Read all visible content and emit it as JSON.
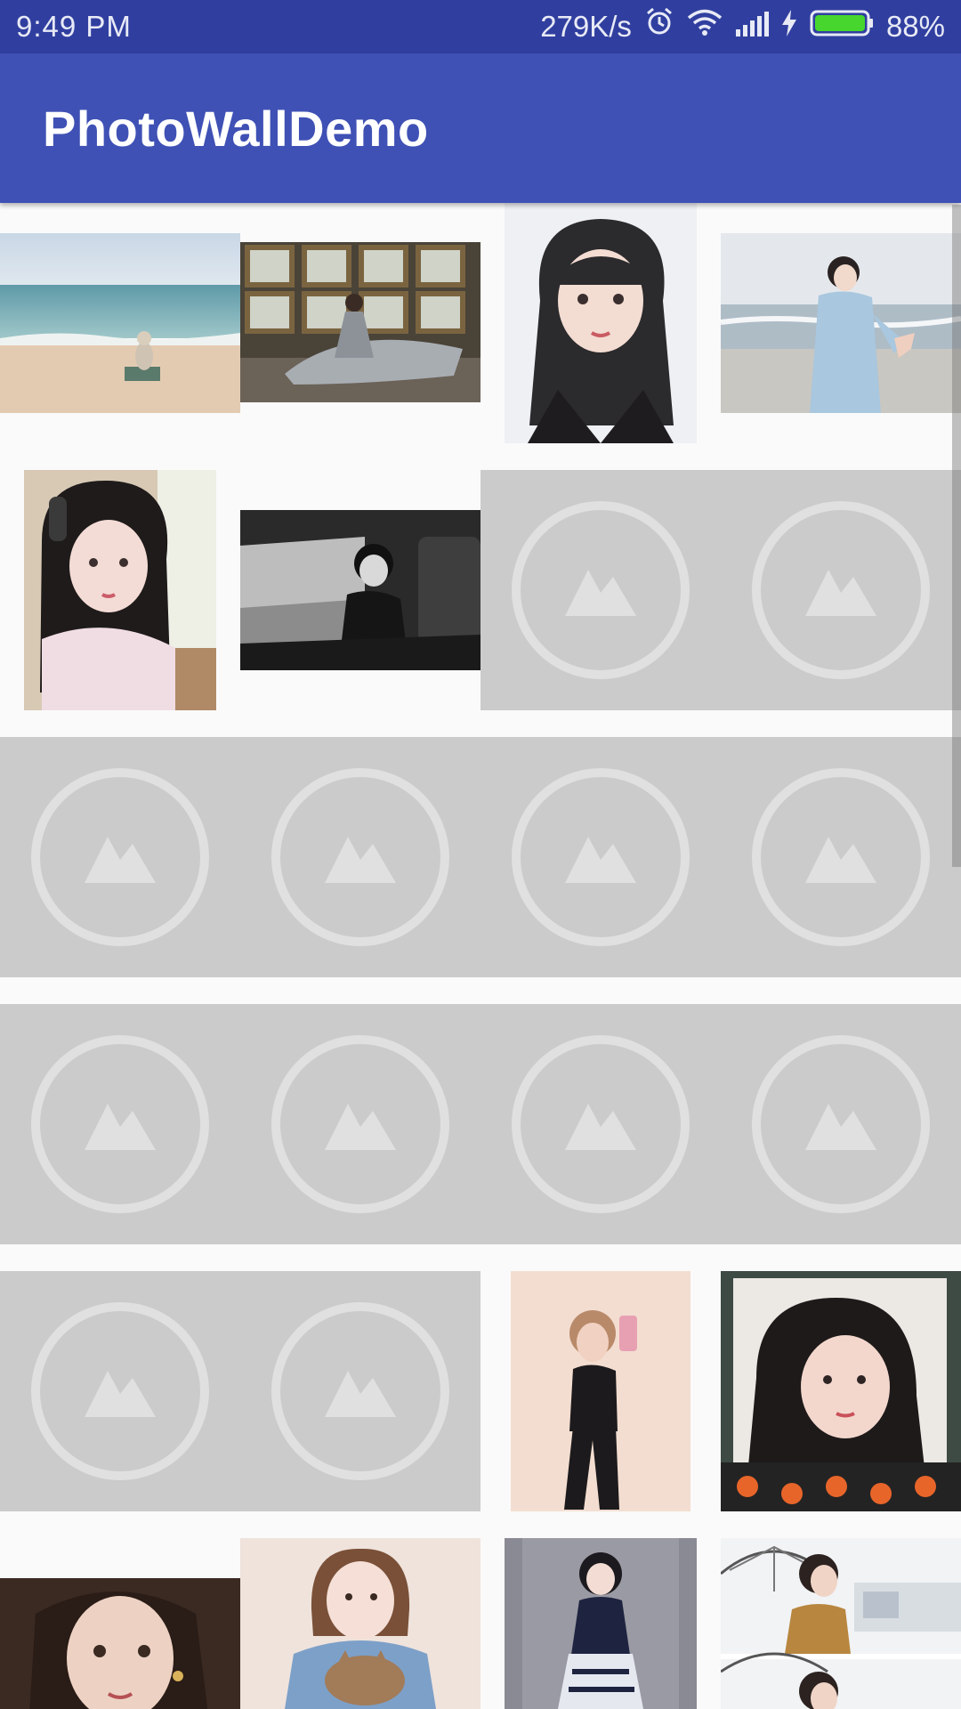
{
  "status_bar": {
    "time": "9:49  PM",
    "net_speed": "279K/s",
    "battery": "88%",
    "icons": [
      "alarm-icon",
      "wifi-icon",
      "signal-icon",
      "charging-bolt-icon",
      "battery-icon"
    ],
    "battery_level": 0.88
  },
  "app_bar": {
    "title": "PhotoWallDemo"
  },
  "colors": {
    "status_bar": "#303f9f",
    "app_bar": "#3f51b5",
    "placeholder_bg": "#cbcbcb",
    "placeholder_icon": "#e0e0e0",
    "background": "#fafafa"
  },
  "grid": {
    "columns": 4,
    "rows": [
      {
        "cells": [
          "beach-sitting",
          "window-gown",
          "portrait-bangs",
          "sea-reaching"
        ]
      },
      {
        "cells": [
          "headphones-selfie",
          "train-bw",
          "placeholder",
          "placeholder"
        ]
      },
      {
        "cells": [
          "placeholder",
          "placeholder",
          "placeholder",
          "placeholder"
        ]
      },
      {
        "cells": [
          "placeholder",
          "placeholder",
          "placeholder",
          "placeholder"
        ]
      },
      {
        "cells": [
          "placeholder",
          "placeholder",
          "mirror-selfie",
          "pumpkin-frame"
        ]
      },
      {
        "cells": [
          "earring-portrait",
          "cat-portrait",
          "lolita-dress",
          "umbrella-street"
        ]
      }
    ],
    "placeholder_icon": "image-placeholder-icon"
  }
}
